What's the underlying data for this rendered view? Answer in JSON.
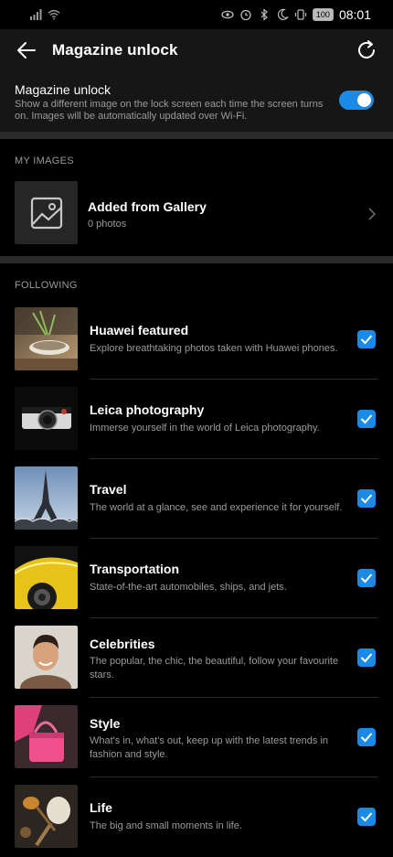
{
  "status": {
    "time": "08:01",
    "battery": "100"
  },
  "appbar": {
    "title": "Magazine unlock"
  },
  "toggle": {
    "title": "Magazine unlock",
    "description": "Show a different image on the lock screen each time the screen turns on. Images will be automatically updated over Wi-Fi.",
    "enabled": true
  },
  "my_images": {
    "header": "MY IMAGES",
    "gallery_title": "Added from Gallery",
    "gallery_count": "0 photos"
  },
  "following": {
    "header": "FOLLOWING",
    "items": [
      {
        "title": "Huawei featured",
        "desc": "Explore breathtaking photos taken with Huawei phones.",
        "checked": true
      },
      {
        "title": "Leica photography",
        "desc": "Immerse yourself in the world of Leica photography.",
        "checked": true
      },
      {
        "title": "Travel",
        "desc": "The world at a glance, see and experience it for yourself.",
        "checked": true
      },
      {
        "title": "Transportation",
        "desc": "State-of-the-art automobiles, ships, and jets.",
        "checked": true
      },
      {
        "title": "Celebrities",
        "desc": "The popular, the chic, the beautiful, follow your favourite stars.",
        "checked": true
      },
      {
        "title": "Style",
        "desc": "What's in, what's out, keep up with the latest trends in fashion and style.",
        "checked": true
      },
      {
        "title": "Life",
        "desc": "The big and small moments in life.",
        "checked": true
      }
    ]
  },
  "colors": {
    "accent": "#1a8ae6",
    "background": "#000000",
    "surface": "#161616"
  }
}
